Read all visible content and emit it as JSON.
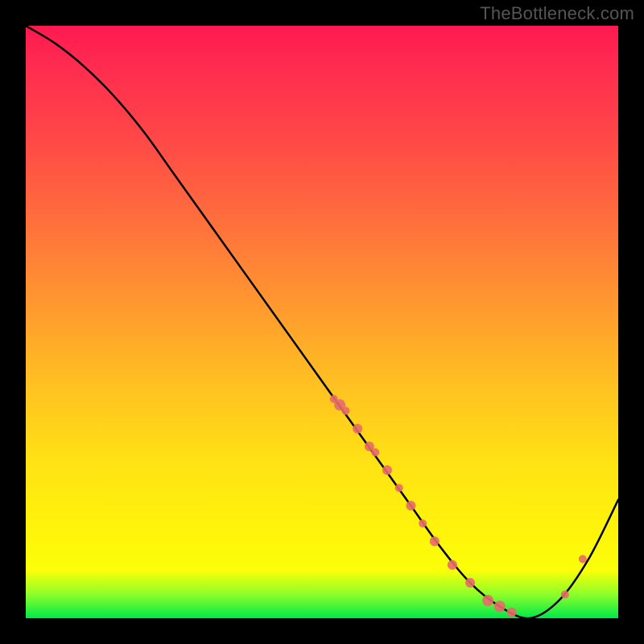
{
  "watermark": "TheBottleneck.com",
  "colors": {
    "background": "#000000",
    "curve": "#000000",
    "dot": "#e86a6a",
    "gradient_top": "#ff1850",
    "gradient_mid": "#ffe314",
    "gradient_bottom": "#00e84a"
  },
  "chart_data": {
    "type": "line",
    "title": "",
    "xlabel": "",
    "ylabel": "",
    "xlim": [
      0,
      100
    ],
    "ylim": [
      0,
      100
    ],
    "series": [
      {
        "name": "bottleneck-curve",
        "x": [
          0,
          5,
          10,
          15,
          20,
          25,
          30,
          35,
          40,
          45,
          50,
          55,
          60,
          65,
          70,
          75,
          80,
          85,
          90,
          95,
          100
        ],
        "y": [
          100,
          97,
          93,
          88,
          82,
          75,
          68,
          61,
          54,
          47,
          40,
          33,
          26,
          19,
          12,
          6,
          2,
          0,
          3,
          10,
          20
        ]
      }
    ],
    "markers": {
      "name": "highlight-dots",
      "x": [
        52,
        53,
        54,
        56,
        58,
        59,
        61,
        63,
        65,
        67,
        69,
        72,
        75,
        78,
        80,
        82,
        91,
        94
      ],
      "y": [
        37,
        36,
        35,
        32,
        29,
        28,
        25,
        22,
        19,
        16,
        13,
        9,
        6,
        3,
        2,
        1,
        4,
        10
      ],
      "r": [
        5,
        7,
        5,
        6,
        6,
        5,
        6,
        5,
        6,
        5,
        6,
        6,
        6,
        7,
        7,
        6,
        5,
        5
      ]
    }
  }
}
